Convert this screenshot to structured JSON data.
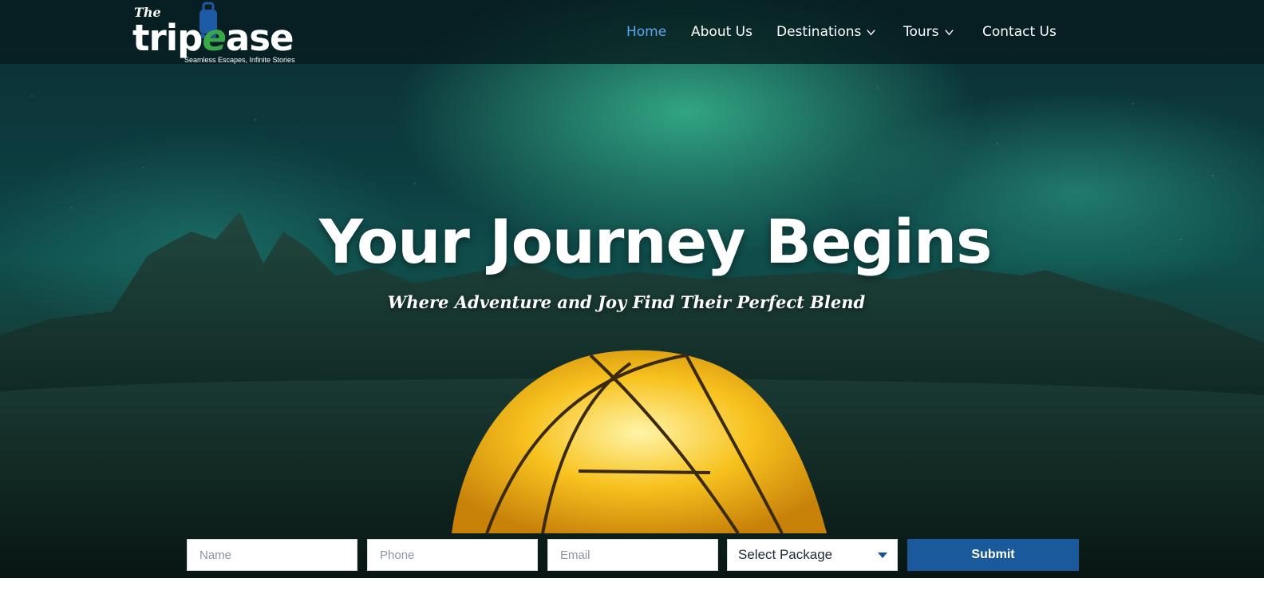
{
  "brand": {
    "logo_the": "The",
    "logo_word_left": "trip",
    "logo_word_mid": "e",
    "logo_word_right": "ase",
    "tagline": "Seamless Escapes, Infinite Stories",
    "accent_color": "#5aa9ee",
    "logo_green": "#3aa84a",
    "logo_blue": "#1f5aa6"
  },
  "nav": {
    "items": [
      {
        "label": "Home",
        "active": true,
        "has_dropdown": false
      },
      {
        "label": "About Us",
        "active": false,
        "has_dropdown": false
      },
      {
        "label": "Destinations",
        "active": false,
        "has_dropdown": true
      },
      {
        "label": "Tours",
        "active": false,
        "has_dropdown": true
      },
      {
        "label": "Contact Us",
        "active": false,
        "has_dropdown": false
      }
    ]
  },
  "hero": {
    "headline": "Your Journey Begins",
    "subheadline": "Where Adventure and Joy Find Their Perfect Blend"
  },
  "form": {
    "name_placeholder": "Name",
    "phone_placeholder": "Phone",
    "email_placeholder": "Email",
    "package_selected": "Select Package",
    "submit_label": "Submit",
    "submit_color": "#1a5a9c"
  },
  "icons": {
    "dropdown": "chevron-down-icon",
    "select_caret": "caret-down-icon",
    "logo_mark": "luggage-icon"
  }
}
